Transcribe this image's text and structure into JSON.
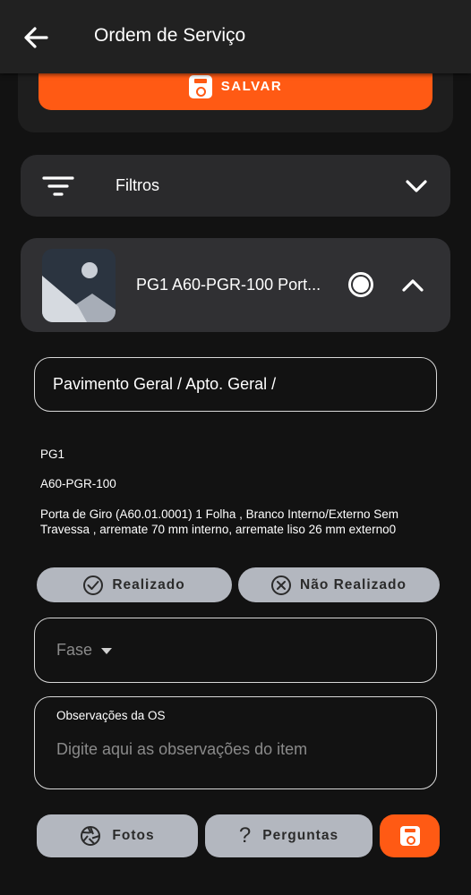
{
  "appbar": {
    "title": "Ordem de Serviço"
  },
  "save_button": {
    "label": "SALVAR"
  },
  "filters": {
    "label": "Filtros"
  },
  "item": {
    "title": "PG1 A60-PGR-100 Port...",
    "path": "Pavimento Geral / Apto. Geral /",
    "code": "PG1",
    "reference": "A60-PGR-100",
    "description": "Porta de Giro (A60.01.0001) 1 Folha , Branco Interno/Externo Sem Travessa , arremate 70 mm interno, arremate liso 26 mm externo0"
  },
  "status": {
    "done_label": "Realizado",
    "not_done_label": "Não Realizado"
  },
  "phase": {
    "placeholder": "Fase"
  },
  "observations": {
    "label": "Observações da OS",
    "placeholder": "Digite aqui as observações do item"
  },
  "actions": {
    "photos_label": "Fotos",
    "questions_label": "Perguntas"
  },
  "colors": {
    "accent": "#ff5a14",
    "background": "#121212",
    "card": "#2a2a2c",
    "button_gray": "#b3b7bf"
  }
}
